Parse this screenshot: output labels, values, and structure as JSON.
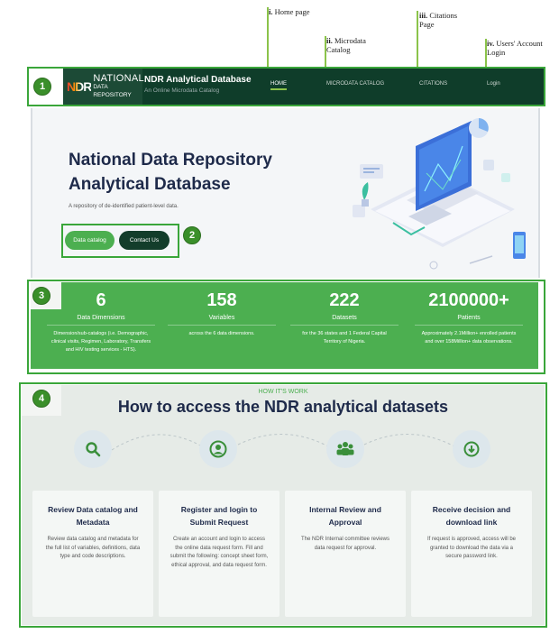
{
  "annotations": [
    {
      "num": "i.",
      "text": "Home page"
    },
    {
      "num": "ii.",
      "text": "Microdata Catalog"
    },
    {
      "num": "iii.",
      "text": "Citations Page"
    },
    {
      "num": "iv.",
      "text": "Users' Account Login"
    }
  ],
  "badges": [
    "1",
    "2",
    "3",
    "4"
  ],
  "navbar": {
    "logo_mark": "NDR",
    "logo_line1": "NATIONAL",
    "logo_line2": "DATA REPOSITORY",
    "title": "NDR Analytical Database",
    "subtitle": "An Online Microdata Catalog",
    "links": [
      "HOME",
      "MICRODATA CATALOG",
      "CITATIONS",
      "Login"
    ]
  },
  "hero": {
    "title_line1": "National Data Repository",
    "title_line2": "Analytical Database",
    "subtitle": "A repository of de-identified patient-level data.",
    "btn_catalog": "Data catalog",
    "btn_contact": "Contact Us"
  },
  "stats": [
    {
      "value": "6",
      "label": "Data Dimensions",
      "desc": "Dimension/sub-catalogs (i.e. Demographic, clinical visits, Regimen, Laboratory, Transfers and HIV testing services - HTS)."
    },
    {
      "value": "158",
      "label": "Variables",
      "desc": "across the 6 data dimensions."
    },
    {
      "value": "222",
      "label": "Datasets",
      "desc": "for the 36 states and 1 Federal Capital Territory of Nigeria."
    },
    {
      "value": "2100000+",
      "label": "Patients",
      "desc": "Approximately 2.1Million+ enrolled patients and over 158Million+ data observations."
    }
  ],
  "how": {
    "kicker": "HOW IT'S WORK",
    "title": "How to access the NDR analytical datasets",
    "steps": [
      {
        "icon": "search-icon",
        "title": "Review Data catalog and Metadata",
        "desc": "Review data catalog and metadata for the full list of variables, definitions, data type and code descriptions."
      },
      {
        "icon": "user-icon",
        "title": "Register and login to Submit Request",
        "desc": "Create an account and login to access the online data request form. Fill and submit the following: concept sheet form, ethical approval, and data request form."
      },
      {
        "icon": "team-icon",
        "title": "Internal Review and Approval",
        "desc": "The NDR Internal committee reviews data request for approval."
      },
      {
        "icon": "download-icon",
        "title": "Receive decision and download link",
        "desc": "If request is approved, access will be granted to download the data via a secure password link."
      }
    ]
  },
  "colors": {
    "nav_bg": "#0f3d2a",
    "accent_green": "#4caf50",
    "frame_green": "#3aa63a",
    "title_navy": "#1e2a4a"
  }
}
